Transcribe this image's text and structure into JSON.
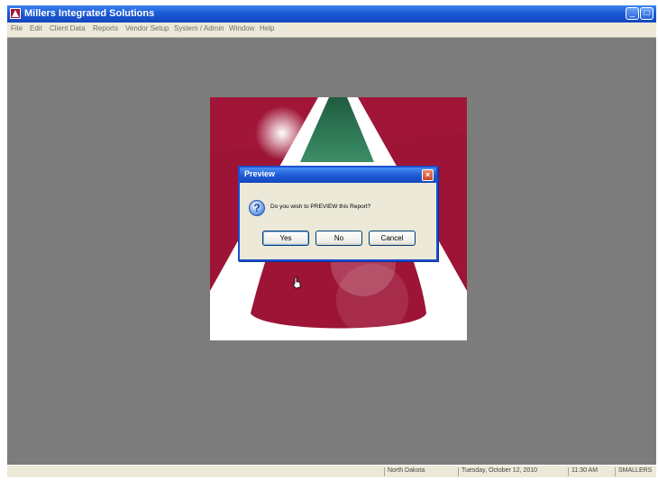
{
  "window": {
    "title": "Millers Integrated Solutions",
    "minimize_glyph": "_",
    "maximize_glyph": "□"
  },
  "menu": {
    "items": [
      "File",
      "Edit",
      "Client Data",
      "Reports",
      "Vendor Setup",
      "System / Admin",
      "Window",
      "Help"
    ]
  },
  "splash": {
    "brand_colors": {
      "maroon": "#9d1436",
      "green": "#2e7d5a",
      "white": "#ffffff"
    }
  },
  "dialog": {
    "title": "Preview",
    "close_glyph": "×",
    "icon": "question-icon",
    "icon_glyph": "?",
    "message": "Do you wish to PREVIEW this Report?",
    "buttons": {
      "yes": "Yes",
      "no": "No",
      "cancel": "Cancel"
    }
  },
  "status": {
    "state": "North Dakota",
    "date": "Tuesday, October 12, 2010",
    "time": "11:30 AM",
    "code": "SMALLERS"
  }
}
